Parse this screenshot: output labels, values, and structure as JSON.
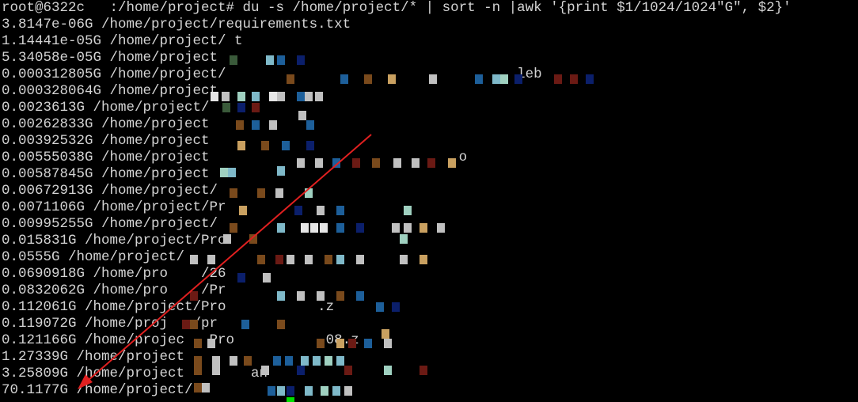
{
  "terminal": {
    "command_line": "root@6322c   :/home/project# du -s /home/project/* | sort -n |awk '{print $1/1024/1024\"G\", $2}'",
    "lines": [
      "3.8147e-06G /home/project/requirements.txt",
      "1.14441e-05G /home/project/ t",
      "5.34058e-05G /home/project",
      "0.000312805G /home/project/                                   leb",
      "0.000328064G /home/project",
      "0.0023613G /home/project/",
      "0.00262833G /home/project",
      "0.00392532G /home/project",
      "0.00555038G /home/project                              o",
      "0.00587845G /home/project",
      "0.00672913G /home/project/",
      "0.0071106G /home/project/Pr",
      "0.00995255G /home/project/",
      "0.015831G /home/project/Pro",
      "0.0555G /home/project/",
      "0.0690918G /home/pro    /26",
      "0.0832062G /home/pro    /Pr",
      "0.112061G /home/project/Pro           .z",
      "0.119072G /home/proj   /pr",
      "0.121166G /home/projec   Pro           08.z",
      "1.27339G /home/project",
      "3.25809G /home/project        an",
      "70.1177G /home/project/"
    ]
  },
  "annotation": {
    "arrow_color": "#e02020",
    "arrow_target": "70.1177G"
  },
  "colors": {
    "background": "#000000",
    "text": "#d4d4d4",
    "cursor": "#00e000",
    "arrow": "#e02020"
  }
}
